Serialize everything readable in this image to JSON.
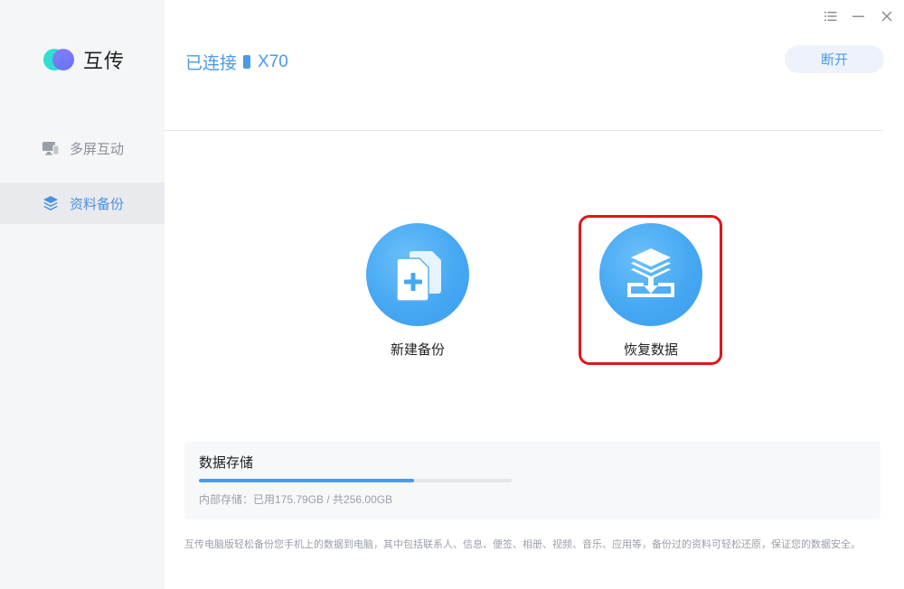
{
  "app": {
    "name": "互传"
  },
  "sidebar": {
    "items": [
      {
        "label": "多屏互动",
        "icon": "monitor-icon",
        "active": false
      },
      {
        "label": "资料备份",
        "icon": "layers-icon",
        "active": true
      }
    ]
  },
  "header": {
    "status_text": "已连接",
    "device_name": "X70",
    "disconnect_label": "断开"
  },
  "window_controls": [
    "menu-icon",
    "minimize-icon",
    "close-icon"
  ],
  "actions": {
    "new_backup": {
      "label": "新建备份",
      "icon": "new-file-icon"
    },
    "restore": {
      "label": "恢复数据",
      "icon": "restore-download-icon",
      "highlighted": true
    }
  },
  "storage": {
    "title": "数据存储",
    "used_fraction": 0.6867,
    "detail": "内部存储：已用175.79GB / 共256.00GB"
  },
  "footer_note": "互传电脑版轻松备份您手机上的数据到电脑，其中包括联系人、信息、便签、相册、视频、音乐、应用等，备份过的资料可轻松还原，保证您的数据安全。",
  "colors": {
    "accent": "#4a9be8",
    "highlight": "#e0161b",
    "sidebar_bg": "#f5f6f8"
  }
}
